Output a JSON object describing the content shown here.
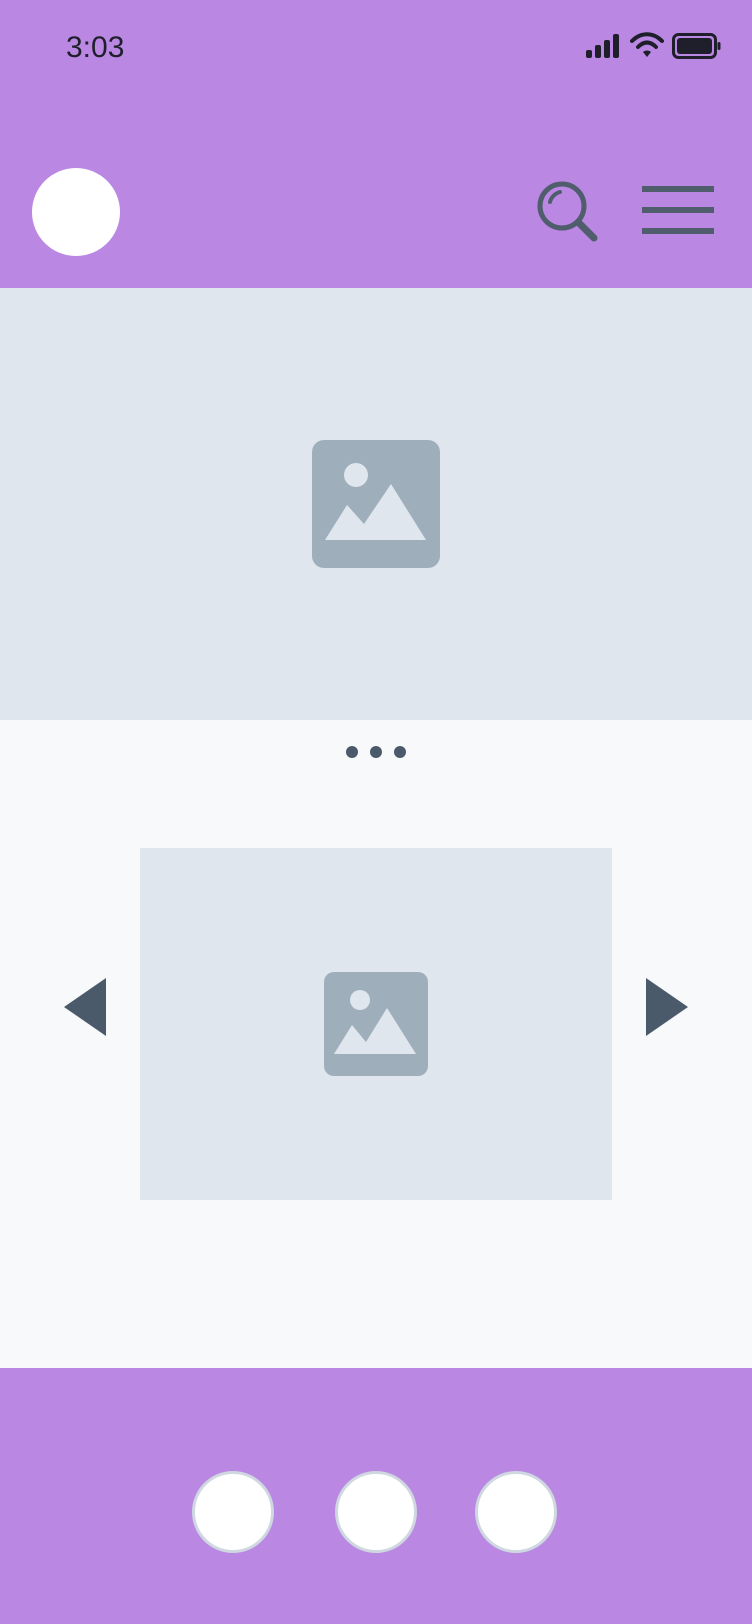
{
  "status_bar": {
    "time": "3:03",
    "icons": [
      "signal-icon",
      "wifi-icon",
      "battery-icon"
    ]
  },
  "header": {
    "avatar": "avatar-placeholder",
    "actions": [
      "search-icon",
      "menu-icon"
    ]
  },
  "hero": {
    "image": "image-placeholder-icon"
  },
  "carousel": {
    "pagination_dots": 3,
    "image": "image-placeholder-icon",
    "prev": "chevron-left-icon",
    "next": "chevron-right-icon"
  },
  "bottom_nav": {
    "buttons": 3
  },
  "colors": {
    "brand_purple": "#ba88e3",
    "placeholder_bg": "#e0e6ee",
    "page_bg": "#f7f9fb",
    "icon_gray": "#9faebb",
    "dark_slate": "#4a5a6a"
  }
}
